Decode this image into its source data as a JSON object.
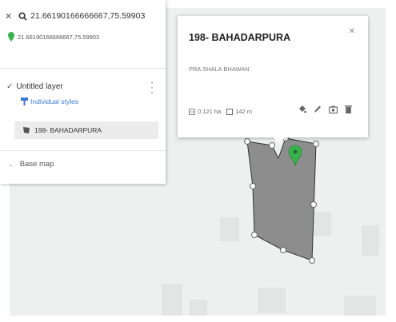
{
  "search": {
    "query": "21.66190166666667,75.59903",
    "result": "21.66190166666667,75.59903"
  },
  "layer": {
    "name": "Untitled layer",
    "styles_link": "Individual styles",
    "feature": "198- BAHADARPURA"
  },
  "basemap": {
    "label": "Base map"
  },
  "card": {
    "title": "198- BAHADARPURA",
    "description": "PRA SHALA BHAWAN",
    "area": "0.121 ha",
    "perimeter": "142 m"
  },
  "colors": {
    "polygon_fill": "#8d8d8d",
    "marker_green": "#37b24d",
    "link_blue": "#3a7bd5"
  },
  "icons": [
    "close-icon",
    "search-icon",
    "pin-icon",
    "checkmark-icon",
    "more-icon",
    "paint-icon",
    "polygon-feature-icon",
    "chevron-icon",
    "ruler-icon",
    "perimeter-icon",
    "edit-style-icon",
    "edit-icon",
    "camera-icon",
    "delete-icon"
  ]
}
